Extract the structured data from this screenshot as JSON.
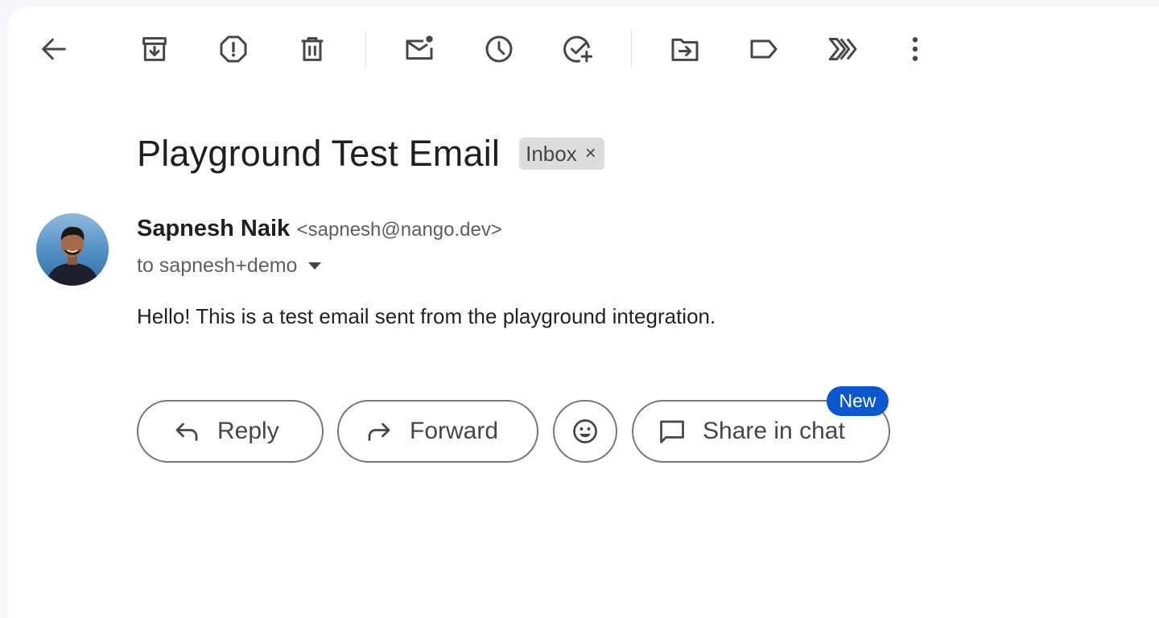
{
  "toolbar": {
    "buttons": [
      {
        "name": "back-icon",
        "tooltip": "Back to Inbox"
      },
      {
        "name": "archive-icon",
        "tooltip": "Archive"
      },
      {
        "name": "report-spam-icon",
        "tooltip": "Report spam"
      },
      {
        "name": "delete-icon",
        "tooltip": "Delete"
      },
      {
        "name": "mark-unread-icon",
        "tooltip": "Mark as unread"
      },
      {
        "name": "snooze-icon",
        "tooltip": "Snooze"
      },
      {
        "name": "add-to-tasks-icon",
        "tooltip": "Add to Tasks"
      },
      {
        "name": "move-to-icon",
        "tooltip": "Move to"
      },
      {
        "name": "label-icon",
        "tooltip": "Labels"
      },
      {
        "name": "filter-similar-icon",
        "tooltip": "Filter messages like these"
      },
      {
        "name": "more-options-icon",
        "tooltip": "More"
      }
    ]
  },
  "email": {
    "subject": "Playground Test Email",
    "label_chip": "Inbox",
    "label_chip_remove": "×",
    "sender_name": "Sapnesh Naik",
    "sender_email": "<sapnesh@nango.dev>",
    "recipients": "to sapnesh+demo",
    "body": "Hello! This is a test email sent from the playground integration."
  },
  "actions": {
    "reply_label": "Reply",
    "forward_label": "Forward",
    "share_label": "Share in chat",
    "new_badge": "New"
  },
  "colors": {
    "accent": "#0b57d0",
    "icon": "#444746",
    "text": "#1f1f1f",
    "chip_bg": "#dddddd"
  }
}
